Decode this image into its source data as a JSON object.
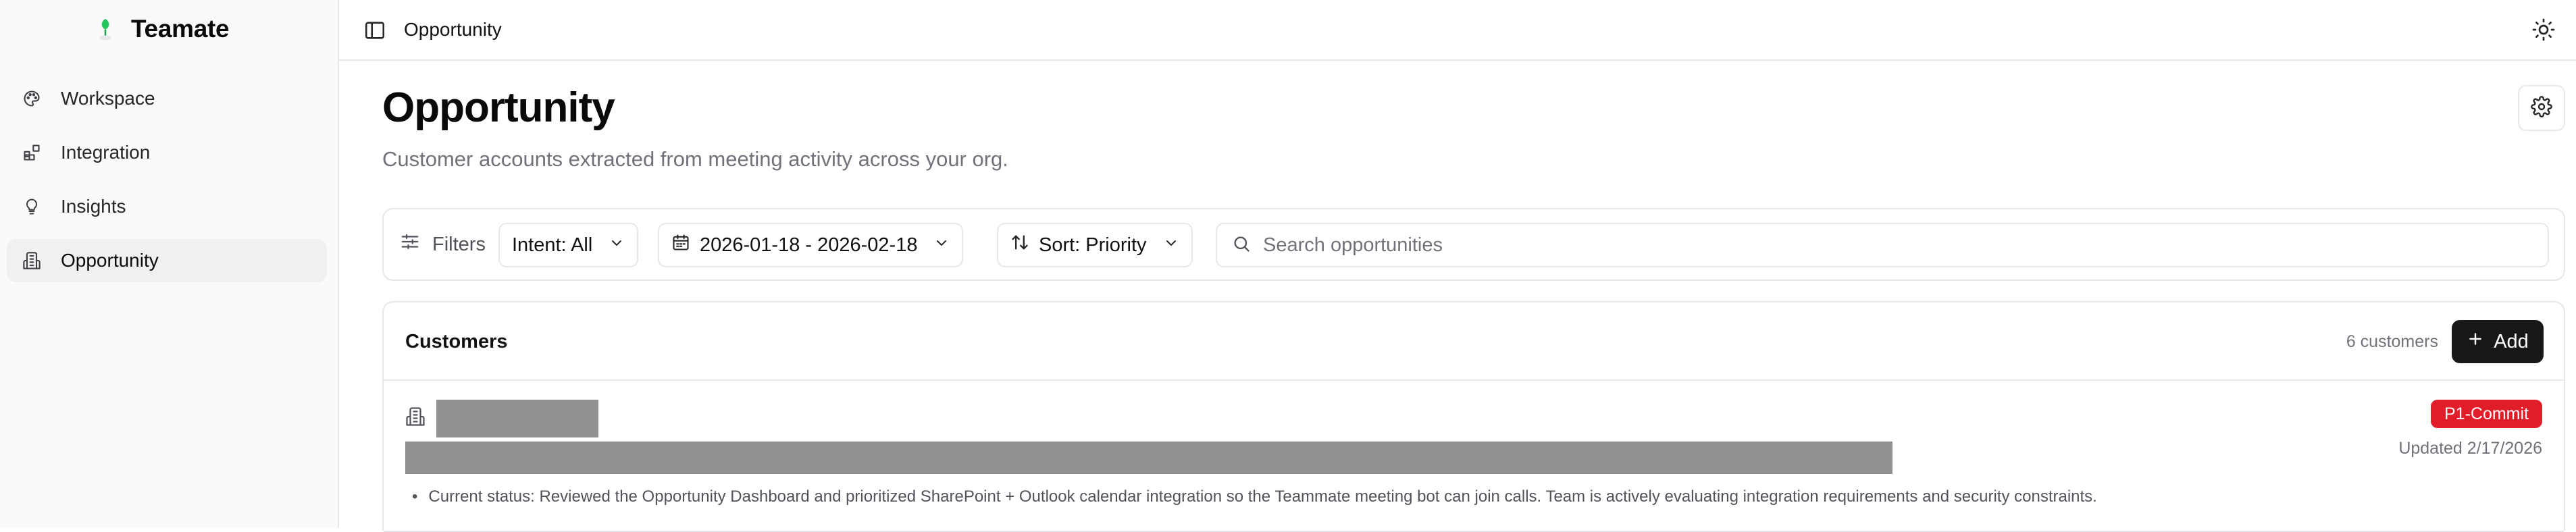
{
  "brand": {
    "name": "Teamate",
    "logo_icon": "leaf-logo-icon"
  },
  "sidebar": {
    "items": [
      {
        "label": "Workspace",
        "icon": "palette-icon",
        "active": false
      },
      {
        "label": "Integration",
        "icon": "blocks-icon",
        "active": false
      },
      {
        "label": "Insights",
        "icon": "lightbulb-icon",
        "active": false
      },
      {
        "label": "Opportunity",
        "icon": "building-icon",
        "active": true
      }
    ]
  },
  "topbar": {
    "breadcrumb": "Opportunity"
  },
  "page": {
    "title": "Opportunity",
    "subtitle": "Customer accounts extracted from meeting activity across your org."
  },
  "filters": {
    "label": "Filters",
    "intent": "Intent: All",
    "date_range": "2026-01-18 - 2026-02-18",
    "sort": "Sort: Priority",
    "search_placeholder": "Search opportunities"
  },
  "customers": {
    "title": "Customers",
    "count": "6 customers",
    "add_label": "Add",
    "rows": [
      {
        "badge": "P1-Commit",
        "updated": "Updated 2/17/2026",
        "status_bullet": "•",
        "status": "Current status: Reviewed the Opportunity Dashboard and prioritized SharePoint + Outlook calendar integration so the Teammate meeting bot can join calls. Team is actively evaluating integration requirements and security constraints."
      }
    ]
  },
  "colors": {
    "accent_dark": "#18181b",
    "badge_red": "#e11d2a",
    "logo_green": "#22c55e",
    "border": "#e5e7eb",
    "muted_text": "#71717a"
  }
}
